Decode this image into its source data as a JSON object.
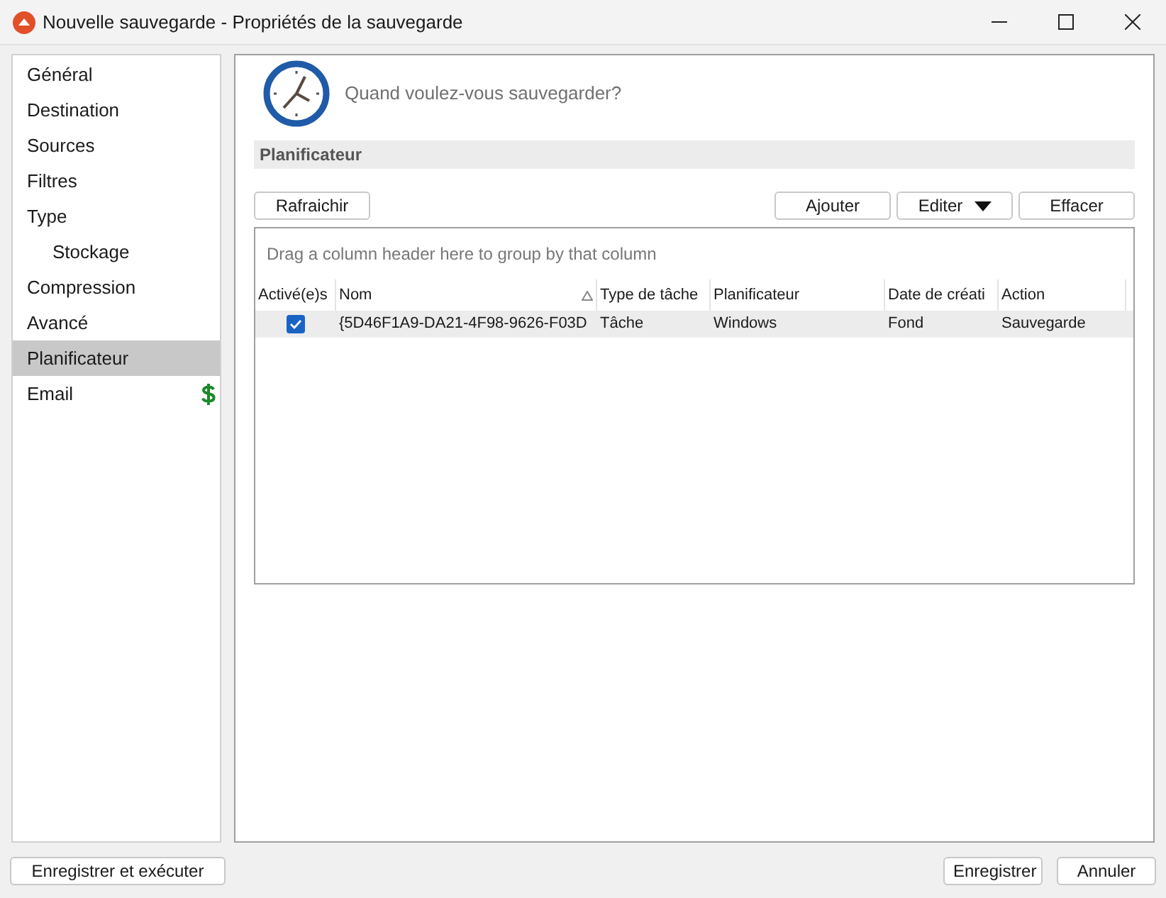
{
  "window": {
    "title": "Nouvelle sauvegarde - Propriétés de la sauvegarde"
  },
  "sidebar": {
    "items": [
      {
        "label": "Général",
        "selected": false,
        "indented": false
      },
      {
        "label": "Destination",
        "selected": false,
        "indented": false
      },
      {
        "label": "Sources",
        "selected": false,
        "indented": false
      },
      {
        "label": "Filtres",
        "selected": false,
        "indented": false
      },
      {
        "label": "Type",
        "selected": false,
        "indented": false
      },
      {
        "label": "Stockage",
        "selected": false,
        "indented": true
      },
      {
        "label": "Compression",
        "selected": false,
        "indented": false
      },
      {
        "label": "Avancé",
        "selected": false,
        "indented": false
      },
      {
        "label": "Planificateur",
        "selected": true,
        "indented": false
      },
      {
        "label": "Email",
        "selected": false,
        "indented": false,
        "paid": true
      }
    ]
  },
  "header": {
    "question": "Quand voulez-vous sauvegarder?"
  },
  "section": {
    "title": "Planificateur"
  },
  "toolbar": {
    "left": [
      {
        "label": "Rafraichir",
        "dropdown": false
      }
    ],
    "right": [
      {
        "label": "Ajouter",
        "dropdown": false
      },
      {
        "label": "Editer",
        "dropdown": true
      },
      {
        "label": "Effacer",
        "dropdown": false
      }
    ]
  },
  "grid": {
    "group_hint": "Drag a column header here to group by that column",
    "columns": [
      {
        "label": "Activé(e)s",
        "sorted": false
      },
      {
        "label": "Nom",
        "sorted": true
      },
      {
        "label": "Type de tâche",
        "sorted": false
      },
      {
        "label": "Planificateur",
        "sorted": false
      },
      {
        "label": "Date de créati",
        "sorted": false
      },
      {
        "label": "Action",
        "sorted": false
      }
    ],
    "rows": [
      {
        "selected": true,
        "checked": true,
        "cells": [
          "",
          "{5D46F1A9-DA21-4F98-9626-F03D",
          "Tâche",
          "Windows",
          "Fond",
          "Sauvegarde"
        ]
      }
    ]
  },
  "footer": {
    "left": [
      "Enregistrer et exécuter"
    ],
    "right": [
      "Enregistrer",
      "Annuler"
    ]
  }
}
